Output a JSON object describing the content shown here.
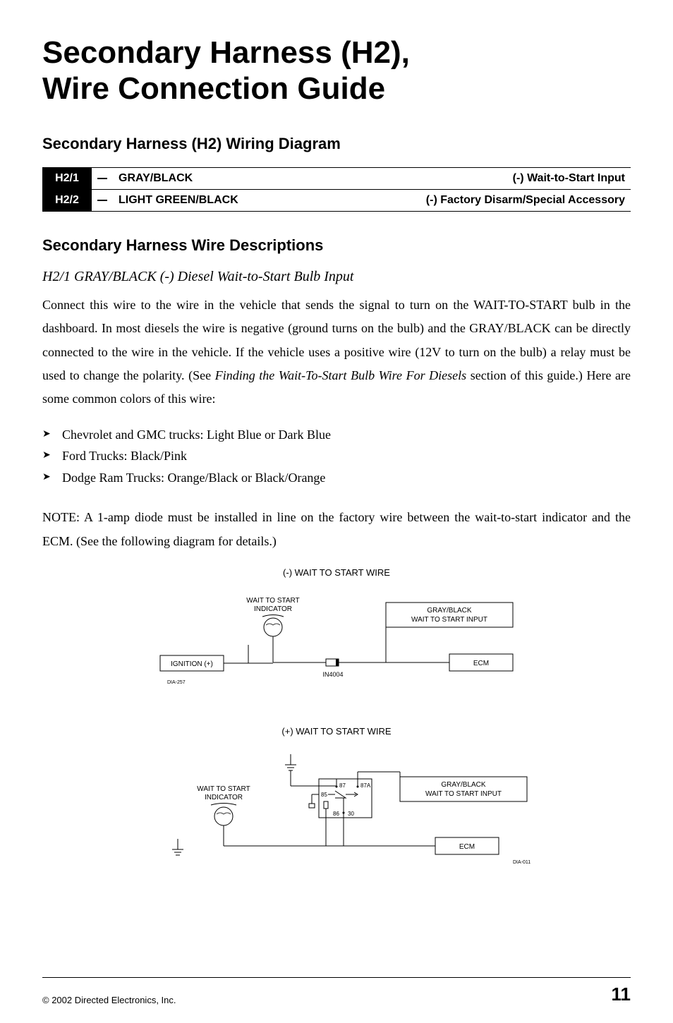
{
  "title_line1": "Secondary Harness (H2),",
  "title_line2": "Wire Connection Guide",
  "section1_heading": "Secondary Harness (H2) Wiring Diagram",
  "wiring": [
    {
      "pin": "H2/1",
      "color": "GRAY/BLACK",
      "function": "(-) Wait-to-Start Input"
    },
    {
      "pin": "H2/2",
      "color": "LIGHT GREEN/BLACK",
      "function": "(-) Factory Disarm/Special Accessory"
    }
  ],
  "section2_heading": "Secondary Harness Wire Descriptions",
  "subheading": "H2/1 GRAY/BLACK (-) Diesel Wait-to-Start Bulb Input",
  "paragraph1": "Connect this wire to the wire in the vehicle that sends the signal to turn on the WAIT-TO-START bulb in the dashboard. In most diesels the wire is negative (ground turns on the bulb) and the GRAY/BLACK can be directly connected to the wire in the vehicle. If the vehicle uses a positive wire (12V to turn on the bulb) a relay must be used to change the polarity. (See ",
  "paragraph1_italic": "Finding the Wait-To-Start Bulb Wire For Diesels",
  "paragraph1_end": " section of this guide.) Here are some common colors of this wire:",
  "bullets": [
    "Chevrolet and GMC trucks: Light Blue or Dark Blue",
    "Ford Trucks: Black/Pink",
    "Dodge Ram Trucks: Orange/Black or Black/Orange"
  ],
  "note": "NOTE: A 1-amp diode must be installed in line on the factory wire between the wait-to-start indicator and the ECM. (See the following diagram for details.)",
  "diagram1_title": "(-) WAIT TO START WIRE",
  "diagram2_title": "(+) WAIT TO START WIRE",
  "diagram_labels": {
    "wait_to_start_indicator": "WAIT TO START\nINDICATOR",
    "ignition": "IGNITION (+)",
    "in4004": "IN4004",
    "ecm": "ECM",
    "gray_black": "GRAY/BLACK\nWAIT TO START INPUT",
    "dia257": "DIA-257",
    "dia011": "DIA-011",
    "relay_87": "87",
    "relay_87a": "87A",
    "relay_85": "85",
    "relay_86": "86",
    "relay_30": "30"
  },
  "copyright": "© 2002 Directed Electronics, Inc.",
  "page_number": "11"
}
